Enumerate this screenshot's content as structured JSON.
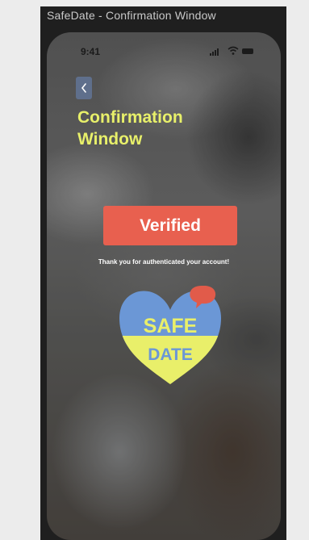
{
  "window": {
    "title": "SafeDate - Confirmation Window"
  },
  "status_bar": {
    "time": "9:41",
    "icons": [
      "signal-icon",
      "wifi-icon",
      "battery-icon"
    ]
  },
  "header": {
    "back_icon": "chevron-left-icon",
    "title": "Confirmation Window"
  },
  "main": {
    "verified_label": "Verified",
    "message": "Thank you for authenticated your account!"
  },
  "logo": {
    "line1": "SAFE",
    "line2": "DATE"
  },
  "colors": {
    "accent_yellow": "#e8f06a",
    "button_red": "#e8604f",
    "heart_blue": "#6b97d6",
    "heart_yellow": "#e9ef6a",
    "bubble_red": "#e15b4a",
    "back_button": "#5f6f8c"
  }
}
